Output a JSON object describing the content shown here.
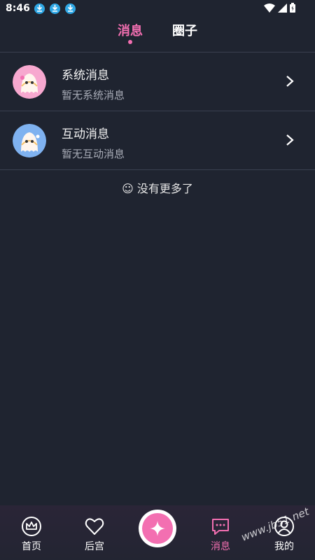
{
  "status_bar": {
    "time": "8:46"
  },
  "top_tabs": [
    {
      "label": "消息",
      "active": true
    },
    {
      "label": "圈子",
      "active": false
    }
  ],
  "messages": [
    {
      "title": "系统消息",
      "subtitle": "暂无系统消息",
      "avatar_color": "#f7a8cf"
    },
    {
      "title": "互动消息",
      "subtitle": "暂无互动消息",
      "avatar_color": "#7fb2f0"
    }
  ],
  "footer_text": "☺ 没有更多了",
  "bottom_nav": [
    {
      "label": "首页",
      "icon": "crown-icon"
    },
    {
      "label": "后宫",
      "icon": "heart-icon"
    },
    {
      "label": "消息",
      "icon": "chat-icon",
      "active": true
    },
    {
      "label": "我的",
      "icon": "user-icon"
    }
  ],
  "watermark": "www.jb51.net",
  "colors": {
    "background": "#1f2430",
    "accent": "#f36fb1"
  }
}
